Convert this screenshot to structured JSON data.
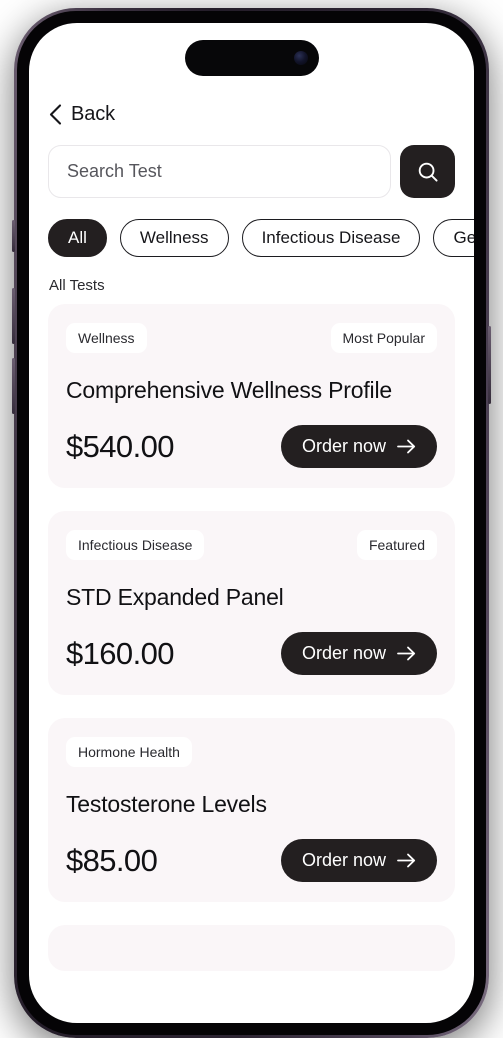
{
  "nav": {
    "back_label": "Back",
    "back_icon": "chevron-left-icon"
  },
  "search": {
    "placeholder": "Search Test",
    "value": "",
    "button_icon": "search-icon"
  },
  "filters": [
    {
      "label": "All",
      "active": true
    },
    {
      "label": "Wellness",
      "active": false
    },
    {
      "label": "Infectious Disease",
      "active": false
    },
    {
      "label": "Ge",
      "active": false
    }
  ],
  "section": {
    "title": "All Tests"
  },
  "cards": [
    {
      "category": "Wellness",
      "badge": "Most Popular",
      "title": "Comprehensive Wellness Profile",
      "price": "$540.00",
      "order_label": "Order now",
      "order_icon": "arrow-right-icon"
    },
    {
      "category": "Infectious Disease",
      "badge": "Featured",
      "title": "STD Expanded Panel",
      "price": "$160.00",
      "order_label": "Order now",
      "order_icon": "arrow-right-icon"
    },
    {
      "category": "Hormone Health",
      "badge": "",
      "title": "Testosterone Levels",
      "price": "$85.00",
      "order_label": "Order now",
      "order_icon": "arrow-right-icon"
    }
  ],
  "colors": {
    "accent_dark": "#231f20",
    "page_background": "#ffffff",
    "card_background": "#faf6f8",
    "tag_background": "#ffffff",
    "text_primary": "#111114",
    "device_frame": "#3b3140"
  }
}
